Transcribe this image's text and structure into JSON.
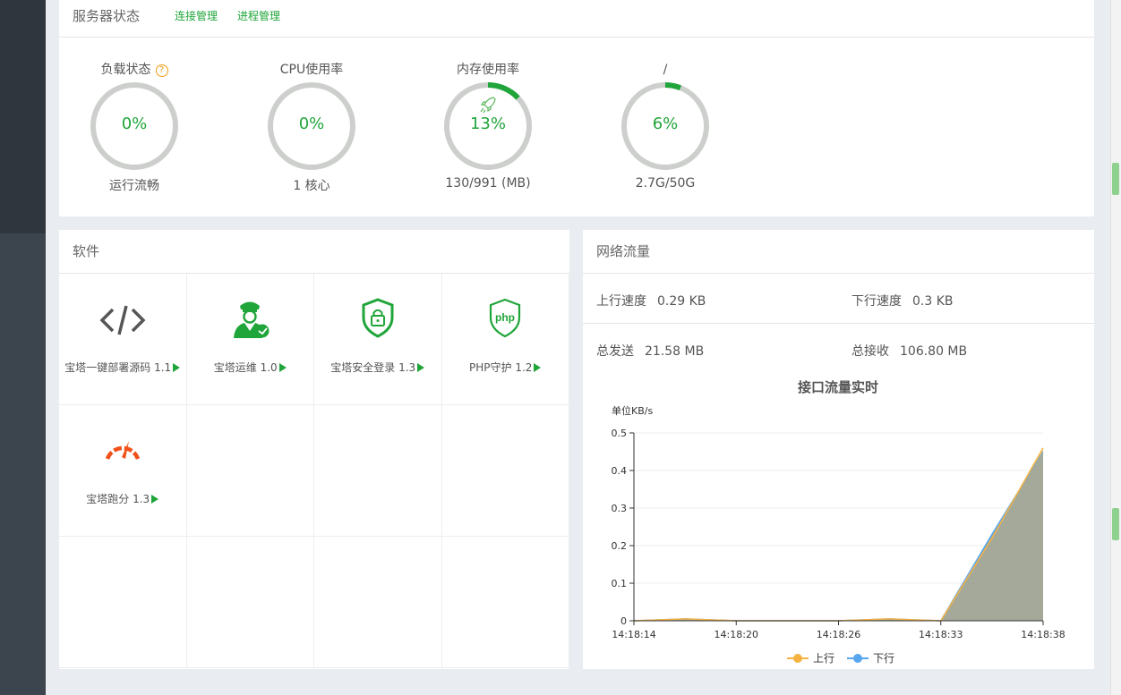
{
  "server_status": {
    "title": "服务器状态",
    "links": [
      "连接管理",
      "进程管理"
    ],
    "gauges": [
      {
        "label": "负载状态",
        "value": "0%",
        "sub": "运行流畅",
        "percent": 0,
        "has_help": true
      },
      {
        "label": "CPU使用率",
        "value": "0%",
        "sub": "1 核心",
        "percent": 0
      },
      {
        "label": "内存使用率",
        "value": "13%",
        "sub": "130/991 (MB)",
        "percent": 13,
        "has_icon": "rocket-icon"
      },
      {
        "label": "/",
        "value": "6%",
        "sub": "2.7G/50G",
        "percent": 6
      }
    ]
  },
  "software": {
    "title": "软件",
    "items": [
      {
        "name": "宝塔一键部署源码 1.1",
        "icon": "code-icon"
      },
      {
        "name": "宝塔运维 1.0",
        "icon": "operator-icon"
      },
      {
        "name": "宝塔安全登录 1.3",
        "icon": "shield-lock-icon"
      },
      {
        "name": "PHP守护 1.2",
        "icon": "php-shield-icon"
      },
      {
        "name": "宝塔跑分 1.3",
        "icon": "speedometer-icon"
      }
    ]
  },
  "network": {
    "title": "网络流量",
    "up_label": "上行速度",
    "up_value": "0.29 KB",
    "down_label": "下行速度",
    "down_value": "0.3 KB",
    "sent_label": "总发送",
    "sent_value": "21.58 MB",
    "recv_label": "总接收",
    "recv_value": "106.80 MB"
  },
  "chart_data": {
    "type": "area",
    "title": "接口流量实时",
    "ylabel": "单位KB/s",
    "ylim": [
      0,
      0.5
    ],
    "yticks": [
      "0",
      "0.1",
      "0.2",
      "0.3",
      "0.4",
      "0.5"
    ],
    "x": [
      "14:18:14",
      "14:18:20",
      "14:18:26",
      "14:18:33",
      "14:18:38"
    ],
    "series": [
      {
        "name": "上行",
        "color": "#f5b342",
        "values": [
          0,
          0,
          0,
          0,
          0.46
        ],
        "pre_rise": [
          0.005,
          0.005,
          0,
          0.005,
          0.22
        ]
      },
      {
        "name": "下行",
        "color": "#58a6ee",
        "values": [
          0,
          0,
          0,
          0,
          0.45
        ],
        "pre_rise": [
          0.005,
          0.005,
          0,
          0.005,
          0.23
        ]
      }
    ],
    "grid": true,
    "legend": "bottom"
  }
}
